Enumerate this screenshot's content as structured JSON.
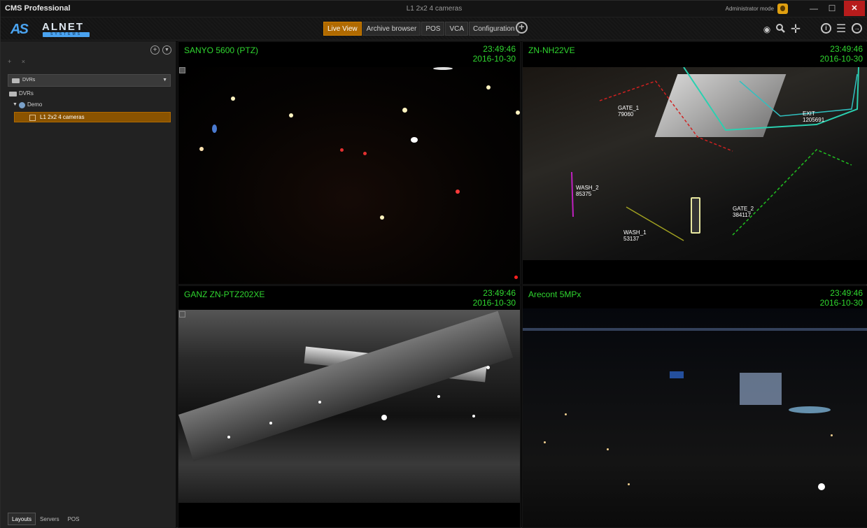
{
  "app": {
    "name": "CMS Professional",
    "window_title": "L1 2x2 4 cameras",
    "user_mode": "Administrator mode"
  },
  "window_controls": {
    "minimize": "—",
    "maximize": "☐",
    "close": "✕"
  },
  "logo": {
    "mark": "AS",
    "name": "ALNET",
    "sub": "SYSTEMS"
  },
  "tabs": [
    {
      "label": "Live View",
      "active": true
    },
    {
      "label": "Archive browser",
      "active": false
    },
    {
      "label": "POS",
      "active": false
    },
    {
      "label": "VCA",
      "active": false
    },
    {
      "label": "Configuration",
      "active": false
    }
  ],
  "toolbar_icons": [
    "eye-icon",
    "zoom-icon",
    "move-icon",
    "info-icon",
    "menu-icon",
    "exit-icon"
  ],
  "sidebar": {
    "dvr_select": "DVRs",
    "tree": [
      {
        "label": "DVRs",
        "icon": "folder-icon"
      },
      {
        "label": "Demo",
        "icon": "globe-icon",
        "expanded": true
      },
      {
        "label": "L1 2x2 4 cameras",
        "icon": "layout-icon",
        "selected": true
      }
    ],
    "bottom_tabs": [
      {
        "label": "Layouts",
        "active": true
      },
      {
        "label": "Servers",
        "active": false
      },
      {
        "label": "POS",
        "active": false
      }
    ]
  },
  "cameras": [
    {
      "name": "SANYO 5600 (PTZ)",
      "time": "23:49:46",
      "date": "2016-10-30"
    },
    {
      "name": "ZN-NH22VE",
      "time": "23:49:46",
      "date": "2016-10-30",
      "vca_labels": [
        {
          "name": "GATE_1",
          "count": "79060"
        },
        {
          "name": "EXIT",
          "count": "1205691"
        },
        {
          "name": "WASH_2",
          "count": "85375"
        },
        {
          "name": "GATE_2",
          "count": "384117"
        },
        {
          "name": "WASH_1",
          "count": "53137"
        }
      ]
    },
    {
      "name": "GANZ ZN-PTZ202XE",
      "time": "23:49:46",
      "date": "2016-10-30"
    },
    {
      "name": "Arecont 5MPx",
      "time": "23:49:46",
      "date": "2016-10-30"
    }
  ],
  "colors": {
    "accent": "#b06a00",
    "overlay_text": "#2fd62f",
    "close": "#b71c1c"
  }
}
